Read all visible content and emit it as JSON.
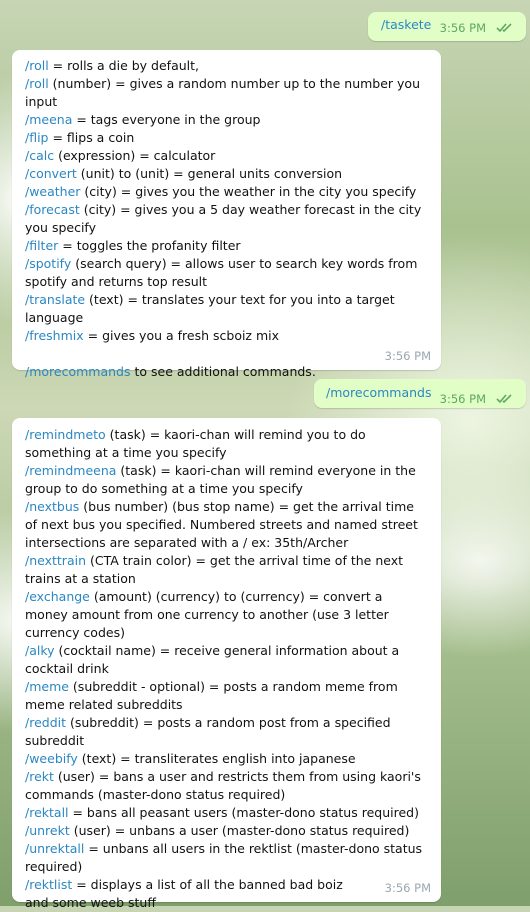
{
  "messages": [
    {
      "text": "/taskete",
      "time": "3:56 PM"
    },
    {
      "time": "3:56 PM",
      "lines": [
        [
          {
            "t": "/roll",
            "cmd": true
          },
          {
            "t": " = rolls a die by default,"
          }
        ],
        [
          {
            "t": "/roll",
            "cmd": true
          },
          {
            "t": " (number) = gives a random number up to the number you input"
          }
        ],
        [
          {
            "t": "/meena",
            "cmd": true
          },
          {
            "t": " = tags everyone in the group"
          }
        ],
        [
          {
            "t": "/flip",
            "cmd": true
          },
          {
            "t": " = flips a coin"
          }
        ],
        [
          {
            "t": "/calc",
            "cmd": true
          },
          {
            "t": " (expression) = calculator"
          }
        ],
        [
          {
            "t": "/convert",
            "cmd": true
          },
          {
            "t": " (unit) to (unit) = general units conversion"
          }
        ],
        [
          {
            "t": "/weather",
            "cmd": true
          },
          {
            "t": " (city) = gives you the weather in the city you specify"
          }
        ],
        [
          {
            "t": "/forecast",
            "cmd": true
          },
          {
            "t": " (city) = gives you a 5 day weather forecast in the city you specify"
          }
        ],
        [
          {
            "t": "/filter",
            "cmd": true
          },
          {
            "t": " = toggles the profanity filter"
          }
        ],
        [
          {
            "t": "/spotify",
            "cmd": true
          },
          {
            "t": " (search query) = allows user to search key words from spotify and returns top result"
          }
        ],
        [
          {
            "t": "/translate",
            "cmd": true
          },
          {
            "t": " (text) = translates your text for you into a target language"
          }
        ],
        [
          {
            "t": "/freshmix",
            "cmd": true
          },
          {
            "t": " = gives you a fresh scboiz mix"
          }
        ],
        [],
        [
          {
            "t": "/morecommands",
            "cmd": true
          },
          {
            "t": " to see additional commands."
          }
        ]
      ]
    },
    {
      "text": "/morecommands",
      "time": "3:56 PM"
    },
    {
      "time": "3:56 PM",
      "lines": [
        [
          {
            "t": "/remindmeto",
            "cmd": true
          },
          {
            "t": " (task) = kaori-chan will remind you to do something at a time you specify"
          }
        ],
        [
          {
            "t": "/remindmeena",
            "cmd": true
          },
          {
            "t": " (task) = kaori-chan will remind everyone in the group to do something at a time you specify"
          }
        ],
        [
          {
            "t": "/nextbus",
            "cmd": true
          },
          {
            "t": " (bus number) (bus stop name) = get the arrival time of next bus you specified. Numbered streets and named street intersections are separated with a / ex: 35th/Archer"
          }
        ],
        [
          {
            "t": "/nexttrain",
            "cmd": true
          },
          {
            "t": " (CTA train color) = get the arrival time of the next trains at a station"
          }
        ],
        [
          {
            "t": "/exchange",
            "cmd": true
          },
          {
            "t": " (amount) (currency) to (currency) = convert a money amount from one currency to another (use 3 letter currency codes)"
          }
        ],
        [
          {
            "t": "/alky",
            "cmd": true
          },
          {
            "t": " (cocktail name) = receive general information about a cocktail drink"
          }
        ],
        [
          {
            "t": "/meme",
            "cmd": true
          },
          {
            "t": " (subreddit - optional) = posts a random meme from meme related subreddits"
          }
        ],
        [
          {
            "t": "/reddit",
            "cmd": true
          },
          {
            "t": " (subreddit) = posts a random post from a specified subreddit"
          }
        ],
        [
          {
            "t": "/weebify",
            "cmd": true
          },
          {
            "t": " (text) = transliterates english into japanese"
          }
        ],
        [
          {
            "t": "/rekt",
            "cmd": true
          },
          {
            "t": " (user) = bans a user and restricts them from using kaori's commands (master-dono status required)"
          }
        ],
        [
          {
            "t": "/rektall",
            "cmd": true
          },
          {
            "t": " = bans all peasant users (master-dono status required)"
          }
        ],
        [
          {
            "t": "/unrekt",
            "cmd": true
          },
          {
            "t": " (user) = unbans a user (master-dono status required)"
          }
        ],
        [
          {
            "t": "/unrektall",
            "cmd": true
          },
          {
            "t": " = unbans all users in the rektlist (master-dono status required)"
          }
        ],
        [
          {
            "t": "/rektlist",
            "cmd": true
          },
          {
            "t": " = displays a list of all the banned bad boiz"
          }
        ],
        [
          {
            "t": "and some weeb stuff"
          }
        ]
      ]
    }
  ],
  "icons": {
    "read_receipt": "double-check-icon"
  },
  "colors": {
    "outgoing_bubble": "#e1fec6",
    "incoming_bubble": "#ffffff",
    "command_link": "#2b87c3",
    "outgoing_time": "#5fa862"
  }
}
